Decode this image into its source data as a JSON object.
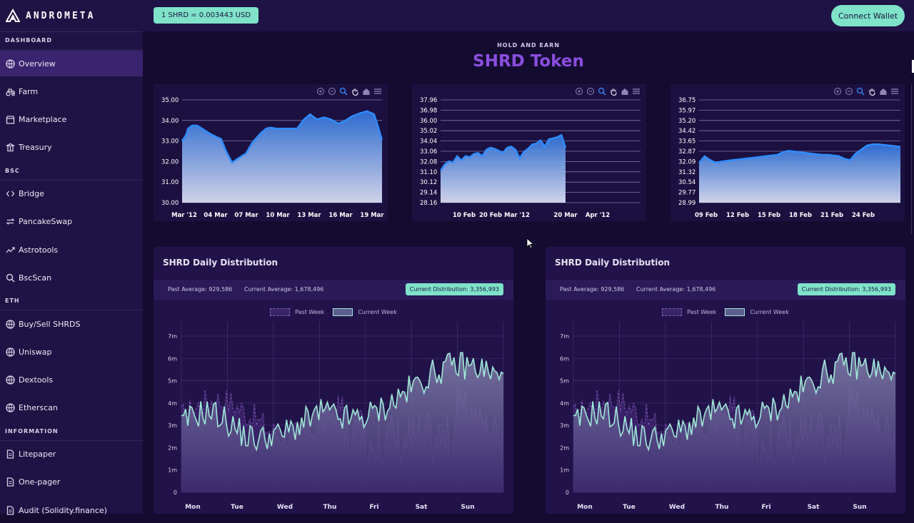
{
  "brand": {
    "name": "ANDROMETA"
  },
  "sidebar": {
    "sections": [
      {
        "title": "DASHBOARD",
        "items": [
          {
            "label": "Overview",
            "icon": "globe-icon",
            "active": true
          },
          {
            "label": "Farm",
            "icon": "tractor-icon"
          },
          {
            "label": "Marketplace",
            "icon": "store-icon"
          },
          {
            "label": "Treasury",
            "icon": "bank-icon"
          }
        ]
      },
      {
        "title": "BSC",
        "items": [
          {
            "label": "Bridge",
            "icon": "code-icon"
          },
          {
            "label": "PancakeSwap",
            "icon": "swap-icon"
          },
          {
            "label": "Astrotools",
            "icon": "trend-icon"
          },
          {
            "label": "BscScan",
            "icon": "search-icon"
          }
        ]
      },
      {
        "title": "ETH",
        "items": [
          {
            "label": "Buy/Sell SHRDS",
            "icon": "globe-icon"
          },
          {
            "label": "Uniswap",
            "icon": "globe-icon"
          },
          {
            "label": "Dextools",
            "icon": "globe-icon"
          },
          {
            "label": "Etherscan",
            "icon": "globe-icon"
          }
        ]
      },
      {
        "title": "INFORMATION",
        "items": [
          {
            "label": "Litepaper",
            "icon": "document-icon"
          },
          {
            "label": "One-pager",
            "icon": "document-icon"
          },
          {
            "label": "Audit (Solidity.finance)",
            "icon": "document-icon"
          }
        ]
      }
    ]
  },
  "header": {
    "price": "1 SHRD = 0.003443 USD",
    "connect": "Connect Wallet"
  },
  "page": {
    "kicker": "HOLD AND EARN",
    "title": "SHRD Token"
  },
  "colors": {
    "accent": "#7ee3c8",
    "purple": "#8a4ee0",
    "line": "#2f8cff",
    "sidebar": "#1f1244"
  },
  "chart_data": [
    {
      "type": "area",
      "yticks": [
        "35.00",
        "34.00",
        "33.00",
        "32.00",
        "31.00",
        "30.00"
      ],
      "ylim": [
        30.0,
        35.0
      ],
      "xticks": [
        "Mar '12",
        "04 Mar",
        "07 Mar",
        "10 Mar",
        "13 Mar",
        "16 Mar",
        "19 Mar"
      ],
      "x": [
        0,
        0.4,
        0.6,
        1.0,
        1.5,
        2.0,
        2.8,
        3.4,
        3.9,
        4.4,
        5.0,
        5.6,
        6.4,
        7.0,
        7.8,
        8.4,
        8.8,
        9.5,
        10.2,
        10.8,
        11.5,
        12.2,
        12.8,
        13.5,
        14.2,
        14.9,
        15.6,
        16.2,
        17.0,
        17.8,
        18.5,
        19.2,
        19.6,
        20.0
      ],
      "values": [
        33.0,
        33.3,
        33.6,
        33.75,
        33.75,
        33.6,
        33.35,
        33.2,
        33.1,
        32.5,
        31.95,
        32.15,
        32.4,
        32.9,
        33.35,
        33.6,
        33.65,
        33.6,
        33.6,
        33.6,
        33.6,
        34.05,
        34.3,
        34.05,
        34.15,
        34.05,
        33.85,
        33.95,
        34.2,
        34.35,
        34.45,
        34.3,
        33.7,
        33.05
      ]
    },
    {
      "type": "area",
      "yticks": [
        "37.96",
        "36.98",
        "36.00",
        "35.02",
        "34.04",
        "33.06",
        "32.08",
        "31.10",
        "30.12",
        "29.14",
        "28.16"
      ],
      "ylim": [
        28.16,
        37.96
      ],
      "xticks": [
        "10 Feb",
        "20 Feb",
        "Mar '12",
        "20 Mar",
        "Apr '12"
      ],
      "x": [
        0,
        0.6,
        1.2,
        1.8,
        2.4,
        3.0,
        3.6,
        4.2,
        4.8,
        5.4,
        6.0,
        6.6,
        7.2,
        7.8,
        8.4,
        9.0,
        9.6,
        10.2,
        10.8,
        11.4,
        12.0,
        12.6,
        13.2,
        13.8,
        14.4,
        15.0,
        15.6,
        16.2,
        16.8,
        17.4,
        18.0
      ],
      "values": [
        31.2,
        31.8,
        32.1,
        32.0,
        32.6,
        32.2,
        32.6,
        32.5,
        32.8,
        32.9,
        32.6,
        33.2,
        33.4,
        33.3,
        33.1,
        32.9,
        33.4,
        33.5,
        33.2,
        32.4,
        33.0,
        33.3,
        33.7,
        33.8,
        34.1,
        33.5,
        34.2,
        34.3,
        34.4,
        34.6,
        33.4
      ]
    },
    {
      "type": "area",
      "yticks": [
        "36.75",
        "35.97",
        "35.20",
        "34.42",
        "33.65",
        "32.87",
        "32.09",
        "31.32",
        "30.54",
        "29.77",
        "28.99"
      ],
      "ylim": [
        28.99,
        36.75
      ],
      "xticks": [
        "09 Feb",
        "12 Feb",
        "15 Feb",
        "18 Feb",
        "21 Feb",
        "24 Feb"
      ],
      "x": [
        0,
        0.5,
        1,
        1.5,
        2,
        2.5,
        3,
        3.5,
        4,
        4.5,
        5,
        5.5,
        6,
        6.5,
        7,
        7.5,
        8,
        8.5,
        9,
        9.5,
        10,
        10.5,
        11,
        11.5,
        12,
        12.5,
        13,
        13.5,
        14,
        14.5,
        15,
        15.5,
        16,
        16.5,
        17,
        17.5,
        18
      ],
      "values": [
        32.0,
        32.5,
        32.2,
        32.0,
        32.1,
        32.15,
        32.2,
        32.25,
        32.3,
        32.35,
        32.4,
        32.45,
        32.5,
        32.55,
        32.6,
        32.8,
        32.9,
        32.85,
        32.8,
        32.75,
        32.7,
        32.65,
        32.6,
        32.6,
        32.55,
        32.5,
        32.3,
        32.2,
        32.7,
        33.0,
        33.3,
        33.4,
        33.4,
        33.35,
        33.3,
        33.25,
        33.2
      ]
    },
    {
      "type": "area",
      "title": "SHRD Daily Distribution",
      "stats": {
        "past": "Past Average: 929,586",
        "current": "Current Average: 1,678,496",
        "distribution": "Current Distribution: 3,356,993"
      },
      "series": [
        {
          "name": "Past Week"
        },
        {
          "name": "Current Week"
        }
      ],
      "yticks": [
        "7m",
        "6m",
        "5m",
        "4m",
        "3m",
        "2m",
        "1m",
        "0"
      ],
      "ylim": [
        0,
        7000000
      ],
      "xticks": [
        "Mon",
        "Tue",
        "Wed",
        "Thu",
        "Fri",
        "Sat",
        "Sun"
      ]
    },
    {
      "type": "area",
      "title": "SHRD Daily Distribution",
      "stats": {
        "past": "Past Average: 929,586",
        "current": "Current Average: 1,678,496",
        "distribution": "Current Distribution: 3,356,993"
      },
      "series": [
        {
          "name": "Past Week"
        },
        {
          "name": "Current Week"
        }
      ],
      "yticks": [
        "7m",
        "6m",
        "5m",
        "4m",
        "3m",
        "2m",
        "1m",
        "0"
      ],
      "ylim": [
        0,
        7000000
      ],
      "xticks": [
        "Mon",
        "Tue",
        "Wed",
        "Thu",
        "Fri",
        "Sat",
        "Sun"
      ]
    }
  ]
}
